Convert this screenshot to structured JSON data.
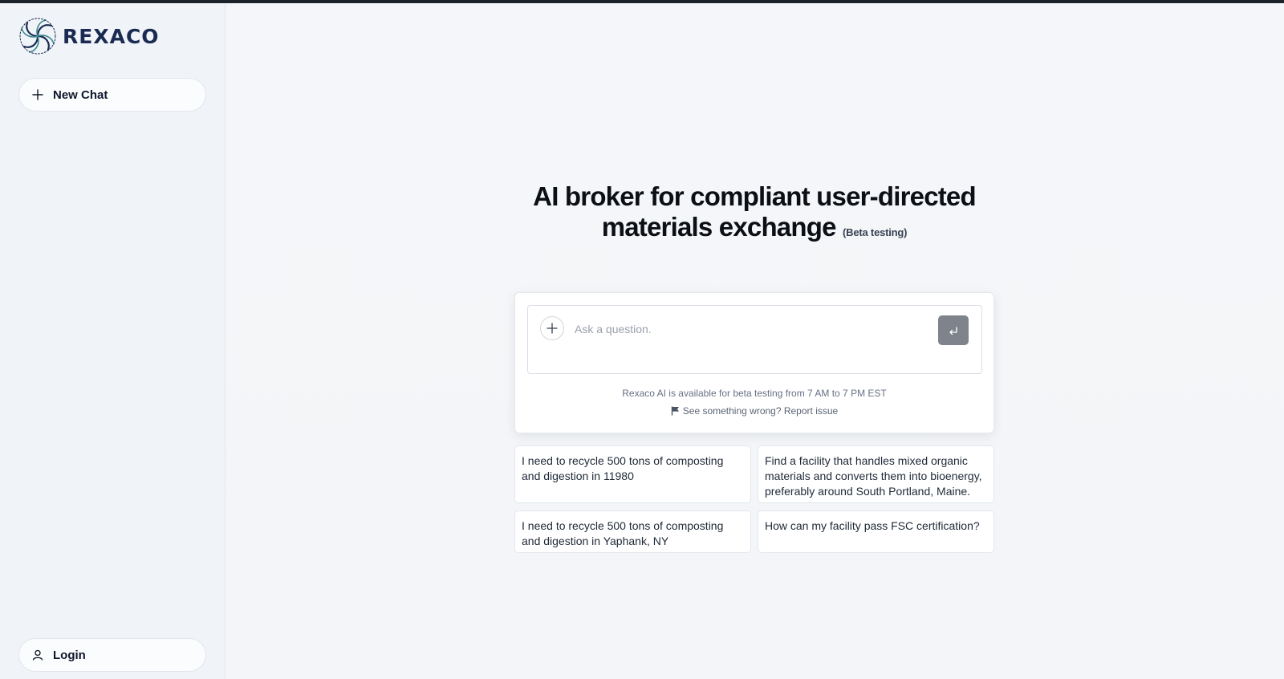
{
  "app": {
    "brand_name": "REXACO",
    "logo_icon": "spiral-logo-icon",
    "brand_color": "#1a2a52",
    "topbar_color": "#1d232b"
  },
  "sidebar": {
    "new_chat": {
      "label": "New Chat",
      "icon": "plus-icon"
    },
    "login": {
      "label": "Login",
      "icon": "user-icon"
    }
  },
  "hero": {
    "title_line1": "AI broker for compliant user-directed",
    "title_line2": "materials exchange",
    "beta_note": "(Beta testing)"
  },
  "chat": {
    "attach_icon": "plus-icon",
    "placeholder": "Ask a question.",
    "value": "",
    "send_icon": "enter-return-icon",
    "availability": "Rexaco AI is available for beta testing from 7 AM to 7 PM EST",
    "report_icon": "flag-icon",
    "report_text": "See something wrong? Report issue"
  },
  "suggestions": [
    {
      "text": "I need to recycle 500 tons of composting and digestion in 11980"
    },
    {
      "text": "Find a facility that handles mixed organic materials and converts them into bioenergy, preferably around South Portland, Maine."
    },
    {
      "text": "I need to recycle 500 tons of composting and digestion in Yaphank, NY"
    },
    {
      "text": "How can my facility pass FSC certification?"
    }
  ]
}
